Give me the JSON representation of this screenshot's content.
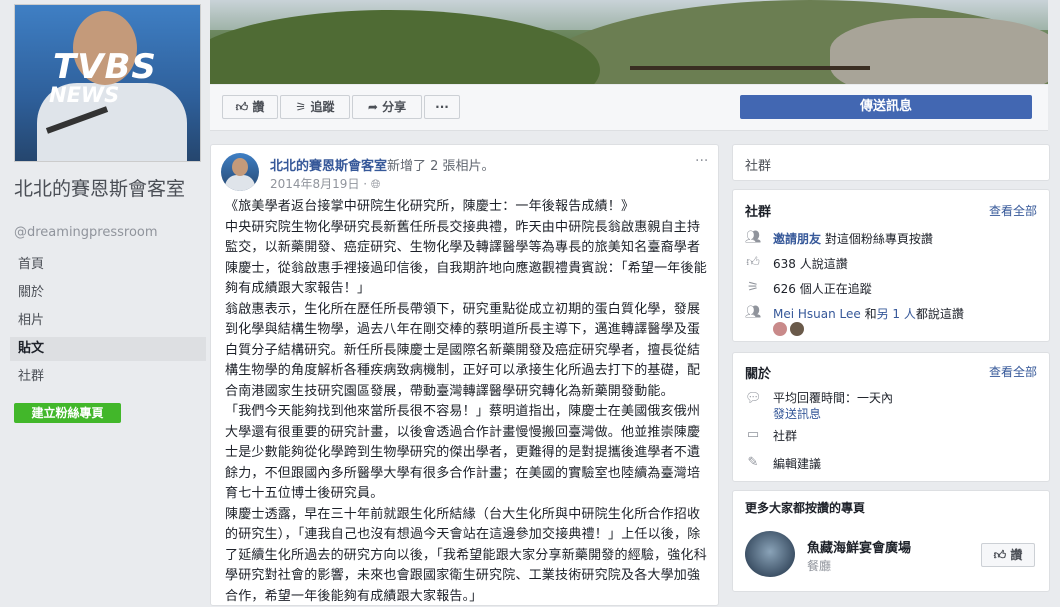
{
  "profile": {
    "logo_main": "TVBS",
    "logo_sub": "NEWS",
    "page_name": "北北的賽恩斯會客室",
    "handle": "@dreamingpressroom"
  },
  "sidebar": {
    "items": [
      {
        "label": "首頁"
      },
      {
        "label": "關於"
      },
      {
        "label": "相片"
      },
      {
        "label": "貼文"
      },
      {
        "label": "社群"
      }
    ],
    "active": "貼文",
    "create_page": "建立粉絲專頁"
  },
  "actions": {
    "like": "讚",
    "follow": "追蹤",
    "share": "分享",
    "more": "···",
    "send_message": "傳送訊息"
  },
  "post": {
    "author": "北北的賽恩斯會客室",
    "activity": "新增了 2 張相片。",
    "date": "2014年8月19日 · ",
    "more": "···",
    "paragraphs": [
      "《旅美學者返台接掌中研院生化研究所，陳慶士：一年後報告成績！》",
      "中央研究院生物化學研究長新舊任所長交接典禮，昨天由中研院長翁啟惠親自主持監交，以新藥開發、癌症研究、生物化學及轉譯醫學等為專長的旅美知名臺裔學者陳慶士，從翁啟惠手裡接過印信後，自我期許地向應邀觀禮貴賓說：「希望一年後能夠有成績跟大家報告！」",
      "翁啟惠表示，生化所在歷任所長帶領下，研究重點從成立初期的蛋白質化學，發展到化學與結構生物學，過去八年在剛交棒的蔡明道所長主導下，邁進轉譯醫學及蛋白質分子結構研究。新任所長陳慶士是國際名新藥開發及癌症研究學者，擅長從結構生物學的角度解析各種疾病致病機制，正好可以承接生化所過去打下的基礎，配合南港國家生技研究園區發展，帶動臺灣轉譯醫學研究轉化為新藥開發動能。",
      "「我們今天能夠找到他來當所長很不容易！」蔡明道指出，陳慶士在美國俄亥俄州大學還有很重要的研究計畫，以後會透過合作計畫慢慢搬回臺灣做。他並推崇陳慶士是少數能夠從化學跨到生物學研究的傑出學者，更難得的是對提攜後進學者不遺餘力，不但跟國內多所醫學大學有很多合作計畫；在美國的實驗室也陸續為臺灣培育七十五位博士後研究員。",
      "陳慶士透露，早在三十年前就跟生化所結緣（台大生化所與中研院生化所合作招收的研究生），「連我自己也沒有想過今天會站在這邊參加交接典禮！」上任以後，除了延續生化所過去的研究方向以後，「我希望能跟大家分享新藥開發的經驗，強化科學研究對社會的影響，未來也會跟國家衛生研究院、工業技術研究院及各大學加強合作，希望一年後能夠有成績跟大家報告。」"
    ]
  },
  "right": {
    "community_title": "社群",
    "community_card": {
      "title": "社群",
      "see_all": "查看全部",
      "invite_link": "邀請朋友",
      "invite_rest": " 對這個粉絲專頁按讚",
      "likes": "638 人說這讚",
      "follows": "626 個人正在追蹤",
      "friend_name": "Mei Hsuan Lee",
      "friend_mid": " 和",
      "friend_others": "另 1 人",
      "friend_rest": "都說這讚"
    },
    "about_card": {
      "title": "關於",
      "see_all": "查看全部",
      "response": "平均回覆時間：一天內",
      "send_message": "發送訊息",
      "community": "社群",
      "edit": "編輯建議"
    },
    "suggest_card": {
      "title": "更多大家都按讚的專頁",
      "page_name": "魚藏海鮮宴會廣場",
      "category": "餐廳",
      "like": "讚"
    }
  }
}
